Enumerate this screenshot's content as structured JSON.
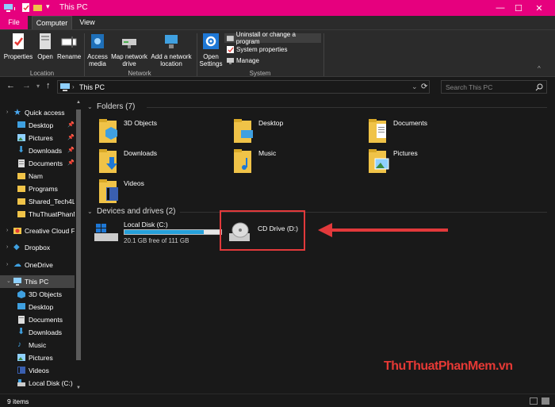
{
  "window": {
    "title": "This PC",
    "controls": {
      "minimize": "—",
      "maximize": "☐",
      "close": "✕"
    }
  },
  "ribbon_tabs": [
    "File",
    "Computer",
    "View"
  ],
  "ribbon": {
    "location": {
      "buttons": [
        "Properties",
        "Open",
        "Rename"
      ],
      "group_label": "Location"
    },
    "network": {
      "access_media": [
        "Access",
        "media"
      ],
      "map_network": [
        "Map network",
        "drive"
      ],
      "add_location": [
        "Add a network",
        "location"
      ],
      "group_label": "Network"
    },
    "system": {
      "open_settings": [
        "Open",
        "Settings"
      ],
      "items": [
        "Uninstall or change a program",
        "System properties",
        "Manage"
      ],
      "group_label": "System"
    }
  },
  "address": {
    "path": "This PC",
    "search_placeholder": "Search This PC"
  },
  "sidebar": {
    "quick_access": "Quick access",
    "quick_items": [
      "Desktop",
      "Pictures",
      "Downloads",
      "Documents",
      "Nam",
      "Programs",
      "Shared_Tech4Lif",
      "ThuThuatPhanM"
    ],
    "creative_cloud": "Creative Cloud Fil",
    "dropbox": "Dropbox",
    "onedrive": "OneDrive",
    "this_pc": "This PC",
    "pc_items": [
      "3D Objects",
      "Desktop",
      "Documents",
      "Downloads",
      "Music",
      "Pictures",
      "Videos",
      "Local Disk (C:)"
    ]
  },
  "content": {
    "folders_header": "Folders (7)",
    "folders": [
      "3D Objects",
      "Desktop",
      "Documents",
      "Downloads",
      "Music",
      "Pictures",
      "Videos"
    ],
    "devices_header": "Devices and drives (2)",
    "local_disk": {
      "name": "Local Disk (C:)",
      "free": "20.1 GB free of 111 GB",
      "used_fraction": 0.82
    },
    "cd_drive": {
      "name": "CD Drive (D:)"
    }
  },
  "status": {
    "items": "9 items"
  },
  "watermark": "ThuThuatPhanMem.vn",
  "colors": {
    "accent": "#e6007e",
    "folder": "#f0c348",
    "highlight_box": "#e2393b",
    "disk_bar": "#26a0da"
  }
}
